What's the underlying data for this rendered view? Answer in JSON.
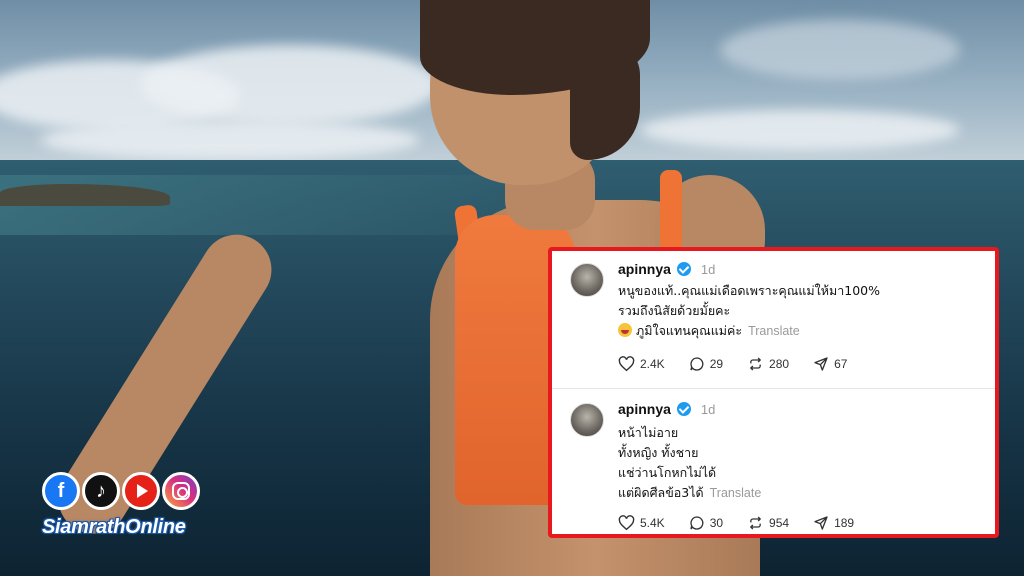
{
  "brand": {
    "name": "SiamrathOnline",
    "social_icons": [
      "facebook-icon",
      "tiktok-icon",
      "youtube-icon",
      "instagram-icon"
    ]
  },
  "colors": {
    "panel_border": "#e8181f",
    "verified": "#1d9bf0",
    "orange_top": "#f07a3e"
  },
  "comments": [
    {
      "username": "apinnya",
      "time": "1d",
      "lines": [
        "หนูของแท้..คุณแม่เดือดเพราะคุณแม่ให้มา100%",
        "รวมถึงนิสัยด้วยมั้ยคะ",
        "ภูมิใจแทนคุณแม่ค่ะ"
      ],
      "emoji": "laughing-emoji",
      "translate": "Translate",
      "likes": "2.4K",
      "replies": "29",
      "reposts": "280",
      "shares": "67"
    },
    {
      "username": "apinnya",
      "time": "1d",
      "lines": [
        "หน้าไม่อาย",
        "ทั้งหญิง ทั้งชาย",
        "แช่ว่านโกหกไม่ได้",
        "แต่ผิดศีลข้อ3ได้"
      ],
      "translate": "Translate",
      "likes": "5.4K",
      "replies": "30",
      "reposts": "954",
      "shares": "189"
    }
  ]
}
